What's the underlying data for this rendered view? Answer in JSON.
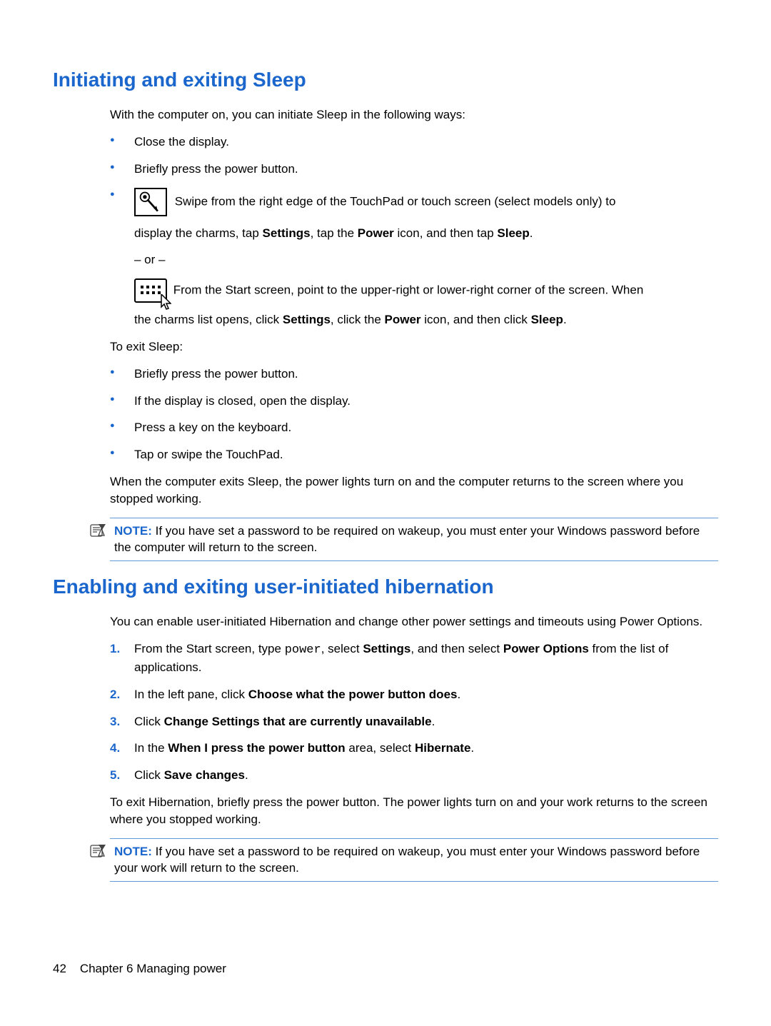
{
  "heading1": "Initiating and exiting Sleep",
  "intro1": "With the computer on, you can initiate Sleep in the following ways:",
  "sleepWays": {
    "close": "Close the display.",
    "power": "Briefly press the power button.",
    "swipe_prefix": " Swipe from the right edge of the TouchPad or touch screen (select models only) to",
    "swipe_line2_a": "display the charms, tap ",
    "swipe_settings": "Settings",
    "swipe_line2_b": ", tap the ",
    "swipe_power": "Power",
    "swipe_line2_c": " icon, and then tap ",
    "swipe_sleep": "Sleep",
    "swipe_line2_d": ".",
    "or": "– or –",
    "start_prefix": " From the Start screen, point to the upper-right or lower-right corner of the screen. When",
    "start_line2_a": "the charms list opens, click ",
    "start_line2_b": ", click the ",
    "start_line2_c": " icon, and then click ",
    "start_line2_d": "."
  },
  "exitLabel": "To exit Sleep:",
  "exitItems": {
    "a": "Briefly press the power button.",
    "b": "If the display is closed, open the display.",
    "c": "Press a key on the keyboard.",
    "d": "Tap or swipe the TouchPad."
  },
  "afterExit": "When the computer exits Sleep, the power lights turn on and the computer returns to the screen where you stopped working.",
  "noteLabel": "NOTE:",
  "note1": " If you have set a password to be required on wakeup, you must enter your Windows password before the computer will return to the screen.",
  "heading2": "Enabling and exiting user-initiated hibernation",
  "intro2": "You can enable user-initiated Hibernation and change other power settings and timeouts using Power Options.",
  "steps": {
    "s1a": "From the Start screen, type ",
    "s1_power": "power",
    "s1b": ", select ",
    "s1_settings": "Settings",
    "s1c": ", and then select ",
    "s1_po": "Power Options",
    "s1d": " from the list of applications.",
    "s2a": "In the left pane, click ",
    "s2b": "Choose what the power button does",
    "s2c": ".",
    "s3a": "Click ",
    "s3b": "Change Settings that are currently unavailable",
    "s3c": ".",
    "s4a": "In the ",
    "s4b": "When I press the power button",
    "s4c": " area, select ",
    "s4d": "Hibernate",
    "s4e": ".",
    "s5a": "Click ",
    "s5b": "Save changes",
    "s5c": "."
  },
  "exitHib": "To exit Hibernation, briefly press the power button. The power lights turn on and your work returns to the screen where you stopped working.",
  "note2": " If you have set a password to be required on wakeup, you must enter your Windows password before your work will return to the screen.",
  "footer": {
    "page": "42",
    "chapter": "Chapter 6   Managing power"
  }
}
